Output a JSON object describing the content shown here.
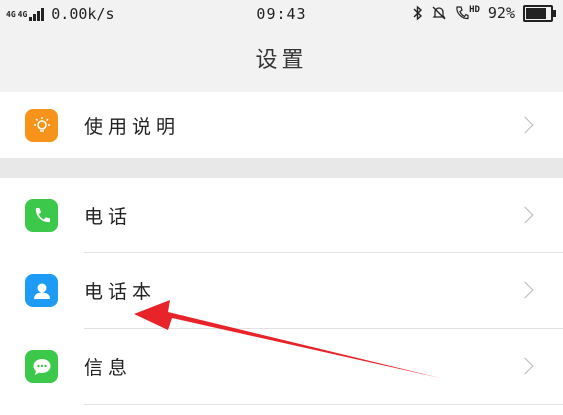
{
  "status_bar": {
    "network_type_top": "4G",
    "network_type_bottom": "4G",
    "speed": "0.00k/s",
    "time": "09:43",
    "hd_label": "HD",
    "battery_percent": "92%",
    "battery_level": 0.92
  },
  "header": {
    "title": "设置"
  },
  "rows": [
    {
      "label": "使用说明",
      "icon": "lightbulb-icon",
      "color": "#f6931b"
    },
    {
      "label": "电话",
      "icon": "phone-icon",
      "color": "#3cc84a"
    },
    {
      "label": "电话本",
      "icon": "contact-icon",
      "color": "#1e9cf5"
    },
    {
      "label": "信息",
      "icon": "message-icon",
      "color": "#3cc84a"
    }
  ],
  "annotation": {
    "arrow_color": "#e8232a"
  }
}
